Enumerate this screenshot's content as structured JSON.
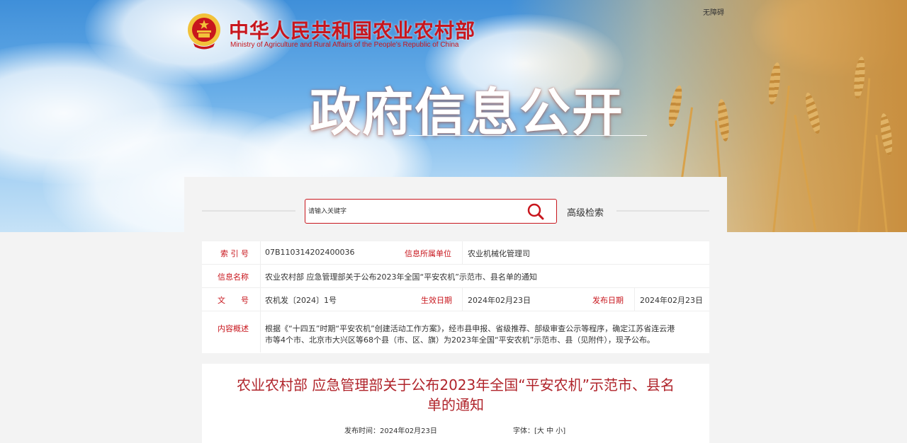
{
  "header": {
    "site_name": "中华人民共和国农业农村部",
    "site_name_en": "Ministry of Agriculture and Rural Affairs of the People's Republic of China",
    "accessibility_link": "无障碍",
    "banner_title": "政府信息公开"
  },
  "search": {
    "placeholder": "请输入关键字",
    "advanced_label": "高级检索"
  },
  "info": {
    "index_label": "索 引 号",
    "index_value": "07B110314202400036",
    "dept_label": "信息所属单位",
    "dept_value": "农业机械化管理司",
    "name_label": "信息名称",
    "name_value": "农业农村部 应急管理部关于公布2023年全国“平安农机”示范市、县名单的通知",
    "docno_label": "文　　号",
    "docno_value": "农机发〔2024〕1号",
    "effective_label": "生效日期",
    "effective_value": "2024年02月23日",
    "publish_label": "发布日期",
    "publish_value": "2024年02月23日",
    "summary_label": "内容概述",
    "summary_line1": "根据《“十四五”时期“平安农机”创建活动工作方案》，经市县申报、省级推荐、部级审查公示等程序，确定江苏省连云港",
    "summary_line2": "市等4个市、北京市大兴区等68个县（市、区、旗）为2023年全国“平安农机”示范市、县（见附件），现予公布。"
  },
  "article": {
    "title": "农业农村部 应急管理部关于公布2023年全国“平安农机”示范市、县名单的通知",
    "publish_time": "发布时间：2024年02月23日",
    "font_size_label": "字体：[大 中 小]"
  },
  "colors": {
    "accent": "#c8161d",
    "article_title": "#b0242b"
  }
}
